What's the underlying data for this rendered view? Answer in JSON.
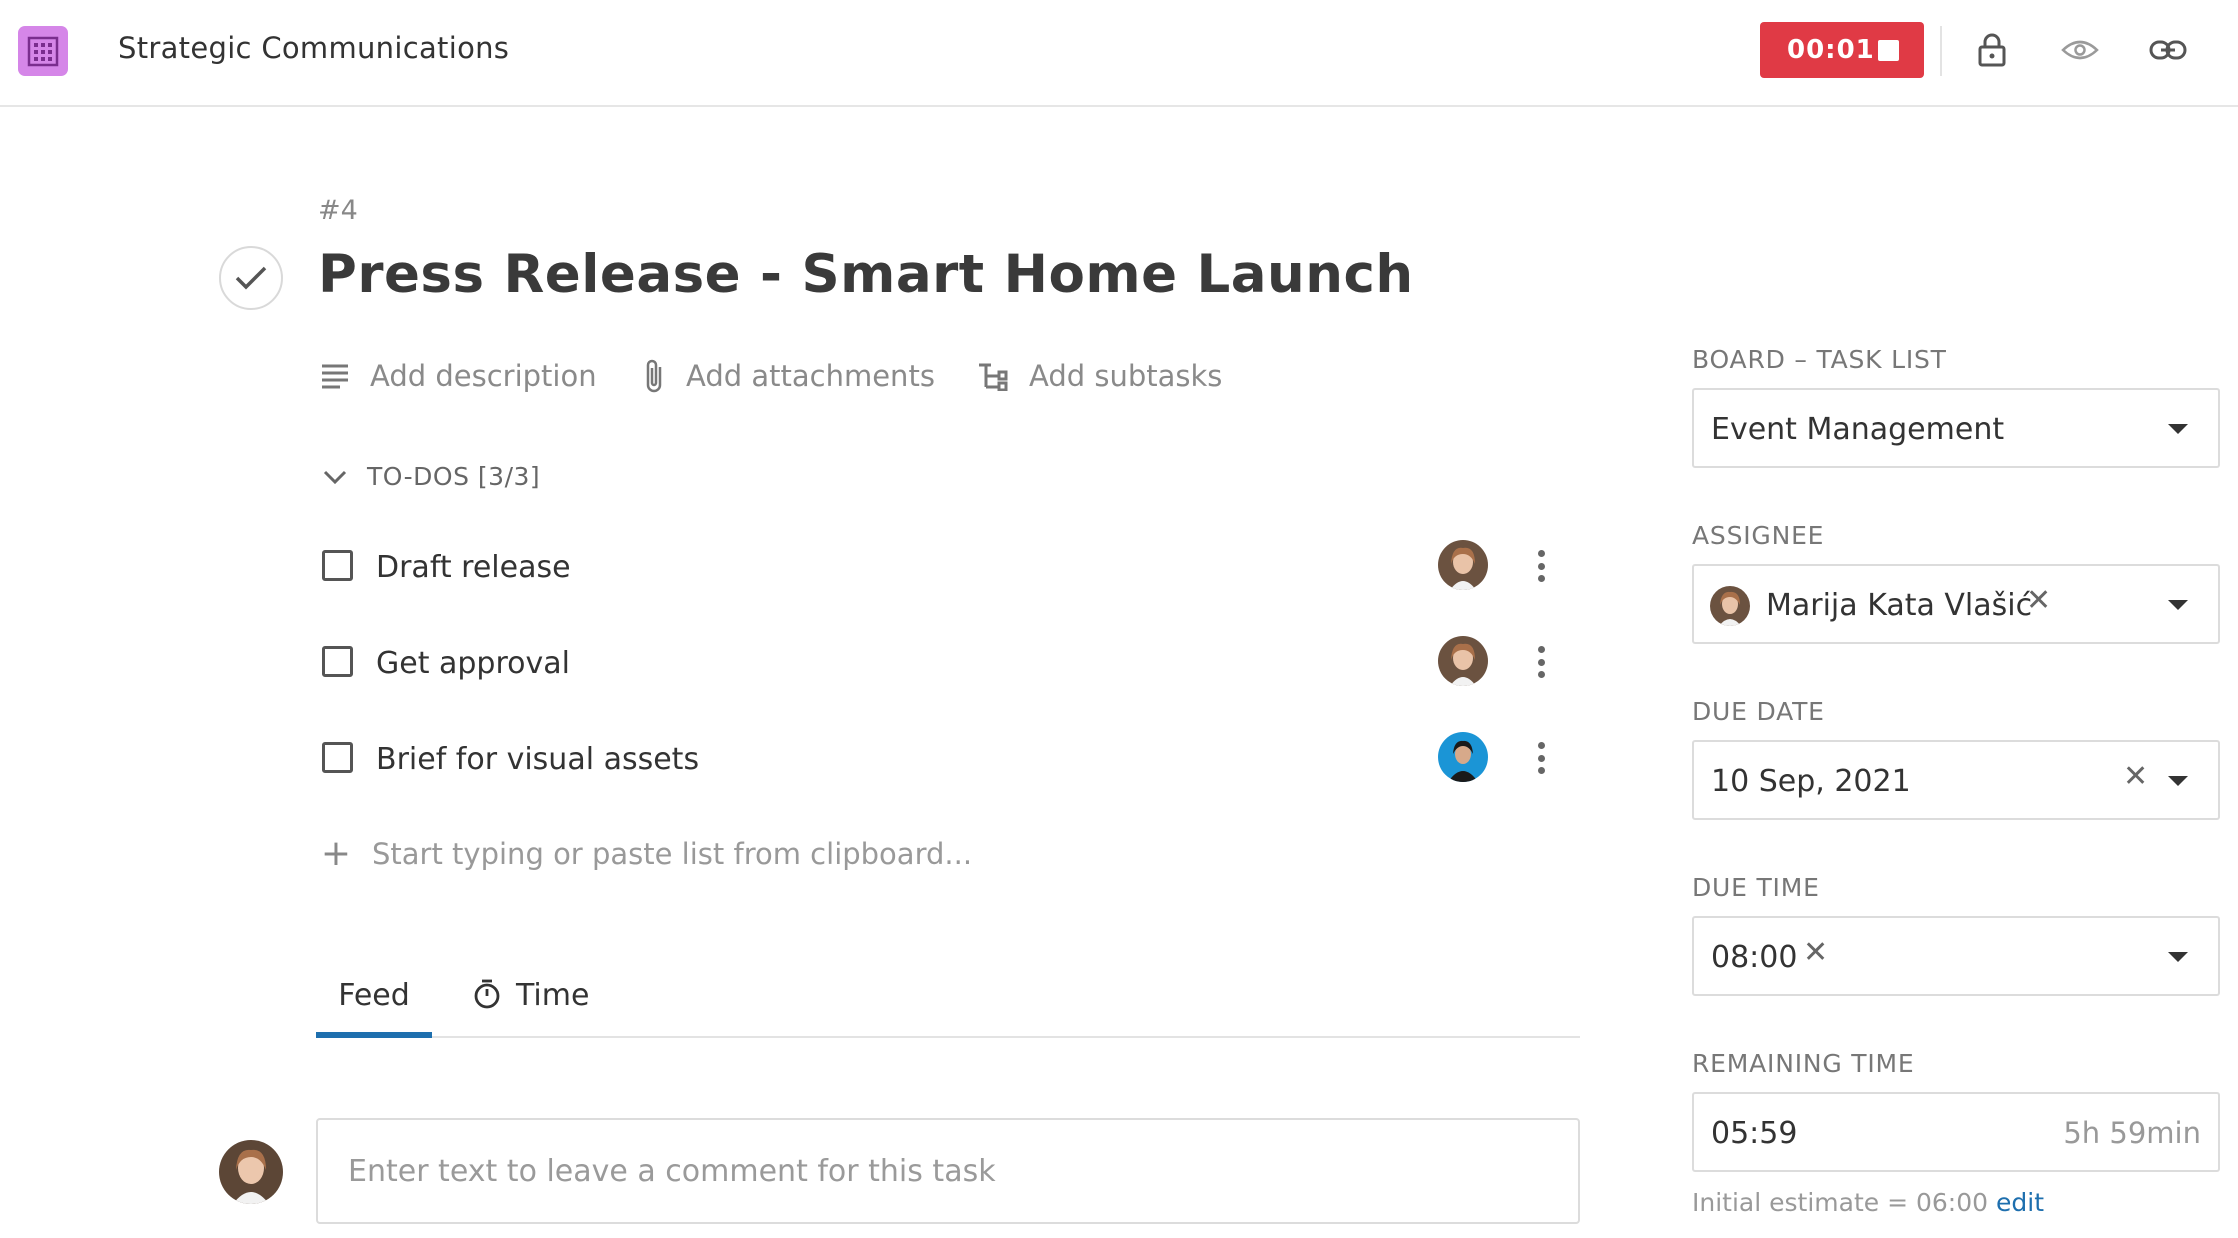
{
  "header": {
    "project_title": "Strategic Communications",
    "timer": "00:01",
    "icons": [
      "building-icon",
      "lock-icon",
      "eye-icon",
      "link-icon"
    ],
    "timer_color": "#e03a45"
  },
  "task": {
    "number": "#4",
    "title": "Press Release - Smart Home Launch"
  },
  "actions": {
    "add_description": "Add description",
    "add_attachments": "Add attachments",
    "add_subtasks": "Add subtasks"
  },
  "todos": {
    "header": "TO-DOS [3/3]",
    "items": [
      {
        "label": "Draft release",
        "checked": false
      },
      {
        "label": "Get approval",
        "checked": false
      },
      {
        "label": "Brief for visual assets",
        "checked": false
      }
    ],
    "add_placeholder": "Start typing or paste list from clipboard..."
  },
  "tabs": {
    "feed": "Feed",
    "time": "Time",
    "active": "Feed"
  },
  "comment": {
    "placeholder": "Enter text to leave a comment for this task"
  },
  "panel": {
    "board_label": "BOARD – TASK LIST",
    "board_value": "Event Management",
    "assignee_label": "ASSIGNEE",
    "assignee_value": "Marija Kata Vlašić",
    "due_date_label": "DUE DATE",
    "due_date_value": "10 Sep, 2021",
    "due_time_label": "DUE TIME",
    "due_time_value": "08:00",
    "remaining_label": "REMAINING TIME",
    "remaining_value": "05:59",
    "remaining_human": "5h 59min",
    "estimate_text": "Initial estimate = 06:00",
    "estimate_edit": "edit"
  },
  "colors": {
    "accent": "#1e6fae",
    "app_icon": "#d586e8"
  }
}
